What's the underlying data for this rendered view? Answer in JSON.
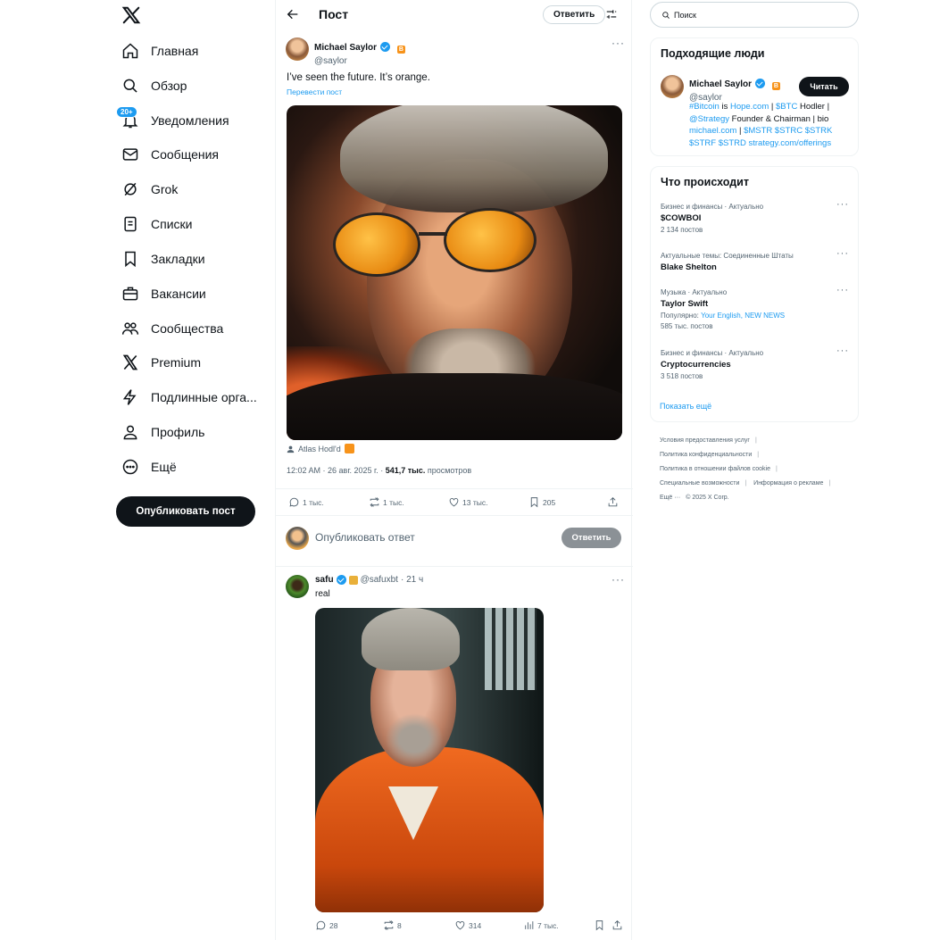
{
  "nav": {
    "notifications_badge": "20+",
    "items": [
      {
        "label": "Главная"
      },
      {
        "label": "Обзор"
      },
      {
        "label": "Уведомления"
      },
      {
        "label": "Сообщения"
      },
      {
        "label": "Grok"
      },
      {
        "label": "Списки"
      },
      {
        "label": "Закладки"
      },
      {
        "label": "Вакансии"
      },
      {
        "label": "Сообщества"
      },
      {
        "label": "Premium"
      },
      {
        "label": "Подлинные орга..."
      },
      {
        "label": "Профиль"
      },
      {
        "label": "Ещё"
      }
    ],
    "post_button": "Опубликовать пост"
  },
  "header": {
    "title": "Пост",
    "reply_button": "Ответить"
  },
  "post": {
    "author_name": "Michael Saylor",
    "author_handle": "@saylor",
    "text": "I’ve seen the future. It’s orange.",
    "translate": "Перевести пост",
    "image_credit": "Atlas Hodl'd",
    "time": "12:02 AM · 26 авг. 2025 г. · ",
    "views_count": "541,7 тыс.",
    "views_label": " просмотров",
    "stats": {
      "replies": "1 тыс.",
      "reposts": "1 тыс.",
      "likes": "13 тыс.",
      "bookmarks": "205"
    }
  },
  "composer": {
    "placeholder": "Опубликовать ответ",
    "button": "Ответить"
  },
  "reply": {
    "author_name": "safu",
    "author_handle": "@safuxbt",
    "age": "· 21 ч",
    "text": "real",
    "stats": {
      "replies": "28",
      "reposts": "8",
      "likes": "314",
      "views": "7 тыс."
    }
  },
  "search": {
    "placeholder": "Поиск"
  },
  "who_to_follow": {
    "title": "Подходящие люди",
    "name": "Michael Saylor",
    "handle": "@saylor",
    "follow_button": "Читать",
    "bio": [
      {
        "t": "#Bitcoin",
        "link": true
      },
      {
        "t": " is ",
        "link": false
      },
      {
        "t": "Hope.com",
        "link": true
      },
      {
        "t": " | ",
        "link": false
      },
      {
        "t": "$BTC",
        "link": true
      },
      {
        "t": " Hodler | ",
        "link": false
      },
      {
        "t": "@Strategy",
        "link": true
      },
      {
        "t": " Founder & Chairman | bio ",
        "link": false
      },
      {
        "t": "michael.com",
        "link": true
      },
      {
        "t": " | ",
        "link": false
      },
      {
        "t": "$MSTR $STRC $STRK $STRF $STRD strategy.com/offerings",
        "link": true
      }
    ]
  },
  "trends": {
    "title": "Что происходит",
    "items": [
      {
        "category": "Бизнес и финансы · Актуально",
        "title": "$COWBOI",
        "count": "2 134 постов"
      },
      {
        "category": "Актуальные темы: Соединенные Штаты",
        "title": "Blake Shelton",
        "count": ""
      },
      {
        "category": "Музыка · Актуально",
        "title": "Taylor Swift",
        "count_prefix": "Популярно: ",
        "count_links": "Your English, NEW NEWS",
        "count": "585 тыс. постов"
      },
      {
        "category": "Бизнес и финансы · Актуально",
        "title": "Cryptocurrencies",
        "count": "3 518 постов"
      }
    ],
    "show_more": "Показать ещё"
  },
  "footer": {
    "links": [
      "Условия предоставления услуг",
      "Политика конфиденциальности",
      "Политика в отношении файлов cookie",
      "Специальные возможности",
      "Информация о рекламе",
      "Ещё ···",
      "© 2025 X Corp."
    ]
  },
  "colors": {
    "accent": "#1d9bf0",
    "btc": "#f7931a",
    "text": "#0f1419",
    "muted": "#536471"
  }
}
